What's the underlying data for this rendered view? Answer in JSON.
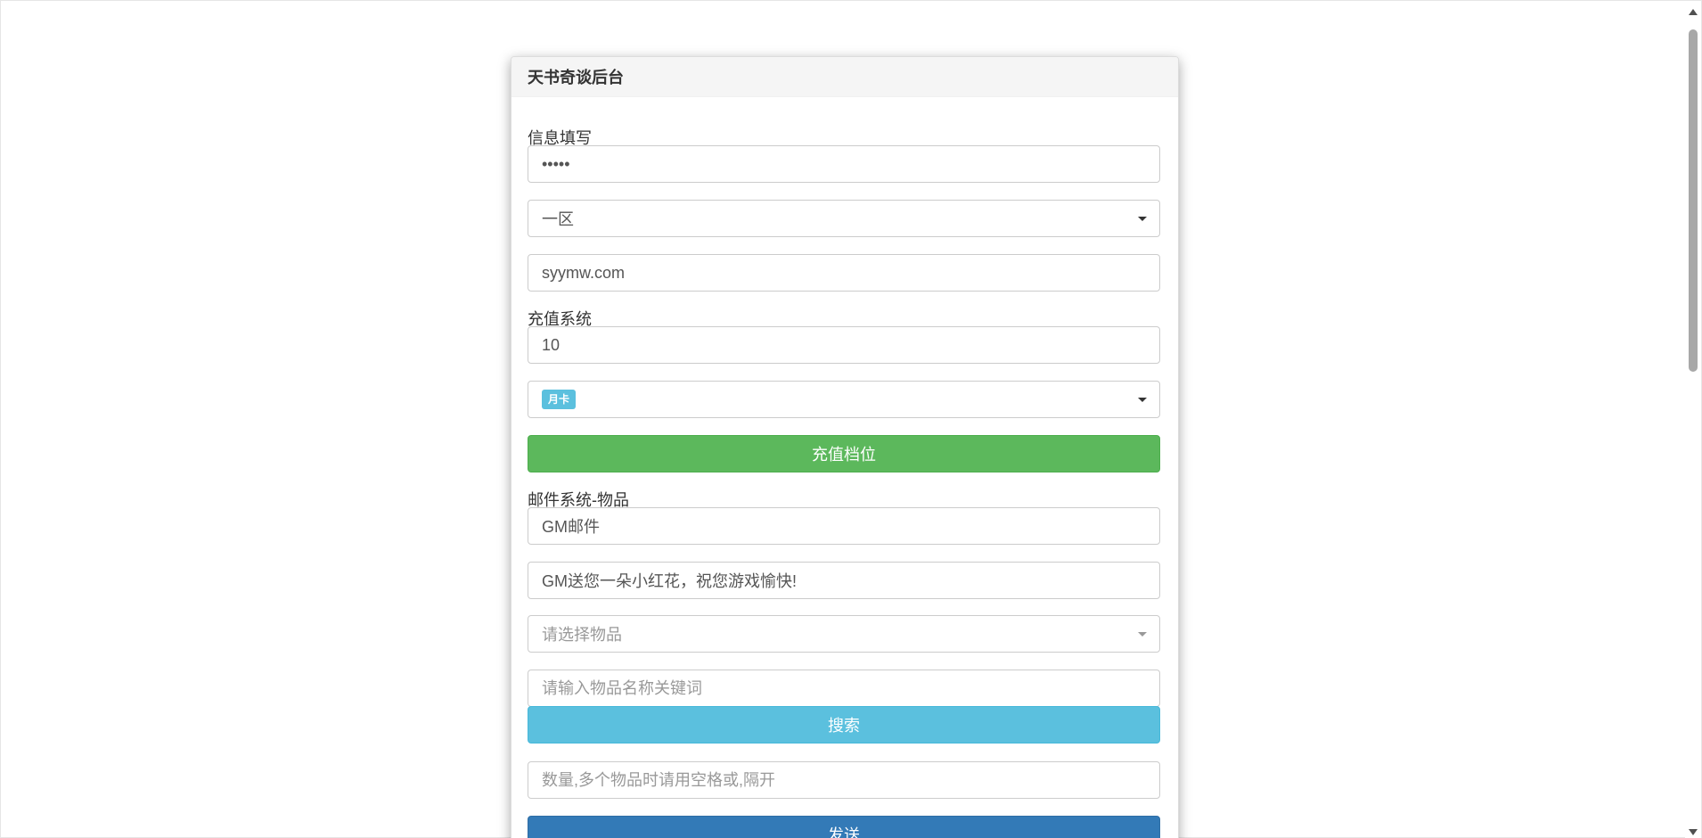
{
  "panel": {
    "title": "天书奇谈后台"
  },
  "info_section": {
    "label": "信息填写",
    "password_value": "•••••",
    "server_select": "一区",
    "account_value": "syymw.com"
  },
  "recharge_section": {
    "label": "充值系统",
    "amount_value": "10",
    "tier_badge": "月卡",
    "submit_label": "充值档位"
  },
  "mail_section": {
    "label": "邮件系统-物品",
    "subject_value": "GM邮件",
    "content_value": "GM送您一朵小红花，祝您游戏愉快!",
    "item_select_placeholder": "请选择物品",
    "search_placeholder": "请输入物品名称关键词",
    "search_label": "搜索",
    "quantity_placeholder": "数量,多个物品时请用空格或,隔开",
    "send_label": "发送"
  },
  "colors": {
    "success": "#5cb85c",
    "info": "#5bc0de",
    "primary": "#337ab7"
  },
  "icons": {
    "dropdown": "caret-down-icon",
    "scroll_up": "scroll-up-arrow-icon",
    "scroll_down": "scroll-down-arrow-icon"
  }
}
